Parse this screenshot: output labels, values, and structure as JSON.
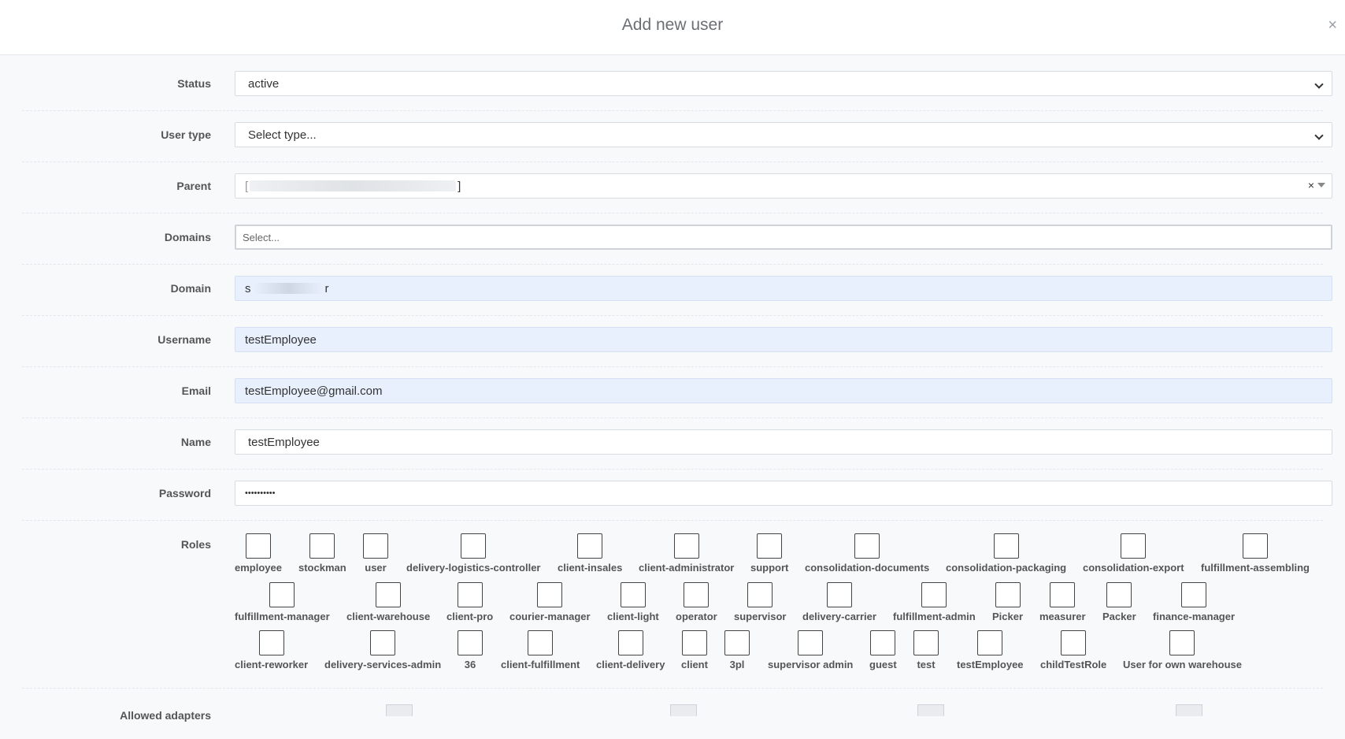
{
  "modal": {
    "title": "Add new user",
    "close_symbol": "×"
  },
  "form": {
    "status": {
      "label": "Status",
      "value": "active"
    },
    "user_type": {
      "label": "User type",
      "placeholder": "Select type..."
    },
    "parent": {
      "label": "Parent",
      "value_start": "[",
      "value_end": "]",
      "clear_symbol": "×"
    },
    "domains": {
      "label": "Domains",
      "placeholder": "Select..."
    },
    "domain": {
      "label": "Domain",
      "value_start": "s",
      "value_end": "r"
    },
    "username": {
      "label": "Username",
      "value": "testEmployee"
    },
    "email": {
      "label": "Email",
      "value": "testEmployee@gmail.com"
    },
    "name": {
      "label": "Name",
      "value": "testEmployee"
    },
    "password": {
      "label": "Password",
      "value": "••••••••••"
    },
    "roles": {
      "label": "Roles",
      "rows": [
        [
          "employee",
          "stockman",
          "user",
          "delivery-logistics-controller",
          "client-insales",
          "client-administrator",
          "support",
          "consolidation-documents",
          "consolidation-packaging",
          "consolidation-export",
          "fulfillment-assembling"
        ],
        [
          "fulfillment-manager",
          "client-warehouse",
          "client-pro",
          "courier-manager",
          "client-light",
          "operator",
          "supervisor",
          "delivery-carrier",
          "fulfillment-admin",
          "Picker",
          "measurer",
          "Packer",
          "finance-manager"
        ],
        [
          "client-reworker",
          "delivery-services-admin",
          "36",
          "client-fulfillment",
          "client-delivery",
          "client",
          "3pl",
          "supervisor admin",
          "guest",
          "test",
          "testEmployee",
          "childTestRole",
          "User for own warehouse"
        ]
      ]
    },
    "allowed_adapters": {
      "label": "Allowed adapters"
    }
  }
}
